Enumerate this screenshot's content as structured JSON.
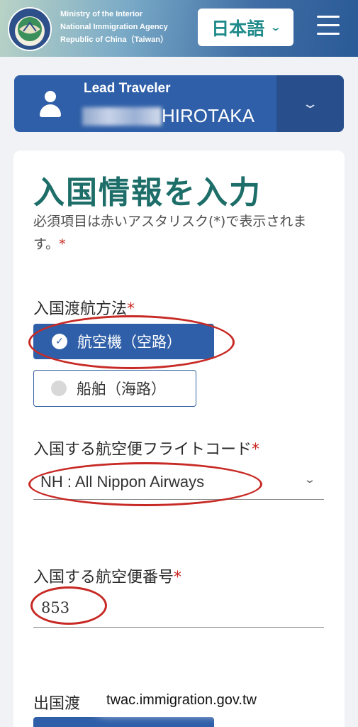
{
  "header": {
    "agency_line1": "Ministry of the Interior",
    "agency_line2": "National Immigration Agency",
    "agency_line3": "Republic of China（Taiwan）",
    "language": "日本語",
    "logo_icon": "national-immigration-agency-seal",
    "menu_icon": "hamburger-menu-icon"
  },
  "traveler": {
    "label": "Lead Traveler",
    "name": "HIROTAKA",
    "icon": "person-icon"
  },
  "form": {
    "title": "入国情報を入力",
    "required_note": "必須項目は赤いアスタリスク(*)で表示されます。",
    "required_mark": "*",
    "transport_label": "入国渡航方法",
    "transport_options": [
      {
        "label": "航空機（空路）",
        "selected": true
      },
      {
        "label": "船舶（海路）",
        "selected": false
      }
    ],
    "flight_code_label": "入国する航空便フライトコード",
    "flight_code_value": "NH : All Nippon Airways",
    "flight_number_label": "入国する航空便番号",
    "flight_number_value": "853",
    "departure_label_partial": "出国渡"
  },
  "browser": {
    "url": "twac.immigration.gov.tw"
  },
  "colors": {
    "brand_blue": "#2f5fa8",
    "title_teal": "#1d6e69",
    "annotation_red": "#c72a25",
    "required_red": "#c8261f"
  }
}
